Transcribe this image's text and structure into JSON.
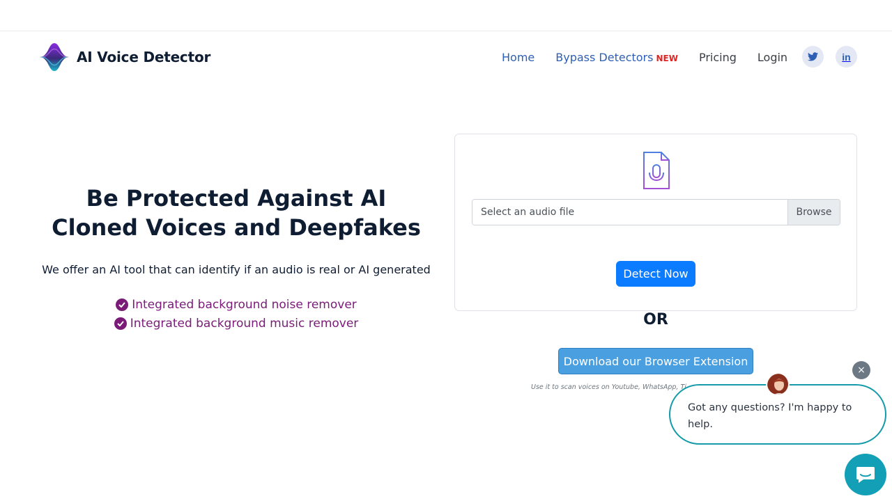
{
  "header": {
    "brand": "AI Voice Detector",
    "nav": {
      "home": "Home",
      "bypass": "Bypass Detectors",
      "bypass_badge": "NEW",
      "pricing": "Pricing",
      "login": "Login"
    },
    "social": {
      "twitter_icon": "twitter-icon",
      "linkedin_icon": "linkedin-icon",
      "linkedin_text": "in"
    }
  },
  "hero": {
    "title": "Be Protected Against AI Cloned Voices and Deepfakes",
    "subtitle": "We offer an AI tool that can identify if an audio is real or AI generated",
    "features": [
      "Integrated background noise remover",
      "Integrated background music remover"
    ]
  },
  "upload": {
    "icon": "audio-file-icon",
    "placeholder": "Select an audio file",
    "browse_label": "Browse",
    "detect_label": "Detect Now"
  },
  "alt": {
    "or_label": "OR",
    "extension_label": "Download our Browser Extension",
    "extension_note": "Use it to scan voices on Youtube, WhatsApp, Ti"
  },
  "chat": {
    "message": "Got any questions? I'm happy to help.",
    "close_glyph": "×"
  },
  "colors": {
    "nav_link": "#2d5fb4",
    "badge_new": "#e02424",
    "feature_purple": "#7a1b78",
    "primary_blue": "#0b7cff",
    "extension_blue": "#4a9fe0",
    "chat_teal": "#159aa9"
  }
}
